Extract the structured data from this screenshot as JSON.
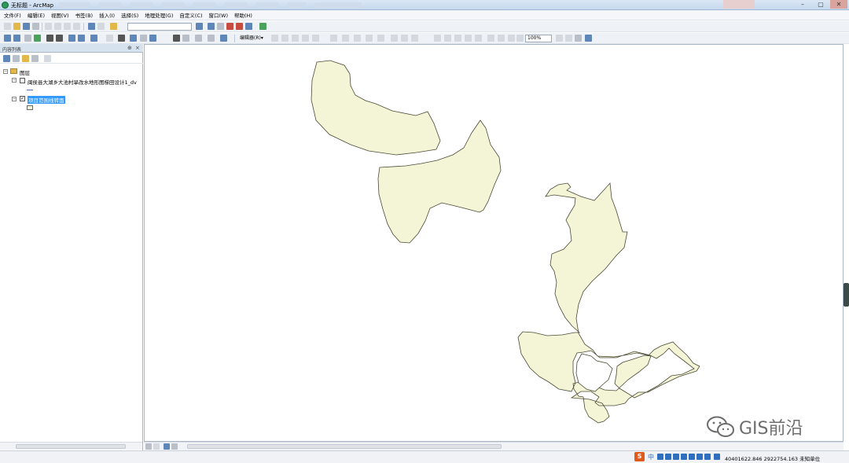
{
  "window": {
    "title": "无标题 - ArcMap"
  },
  "menu": [
    "文件(F)",
    "编辑(E)",
    "视图(V)",
    "书签(B)",
    "插入(I)",
    "选择(S)",
    "地理处理(G)",
    "自定义(C)",
    "窗口(W)",
    "帮助(H)"
  ],
  "toolbar": {
    "editor_label": "编辑器(R)▾",
    "zoom_value": "100%"
  },
  "toc": {
    "title": "内容列表",
    "root_label": "图层",
    "layer1_label": "闽侯县大湖乡大池村旱改水地形图梯田设计1_dv",
    "layer2_label": "项目范围线转面",
    "layer1_checked": false,
    "layer2_checked": true
  },
  "status": {
    "coordinates": "40401622.846  2922754.163 未知单位"
  },
  "watermark": {
    "text": "GIS前沿"
  },
  "colors": {
    "polygon_fill": "#f4f4d7",
    "polygon_stroke": "#4a4a35",
    "selection": "#3399ff"
  }
}
